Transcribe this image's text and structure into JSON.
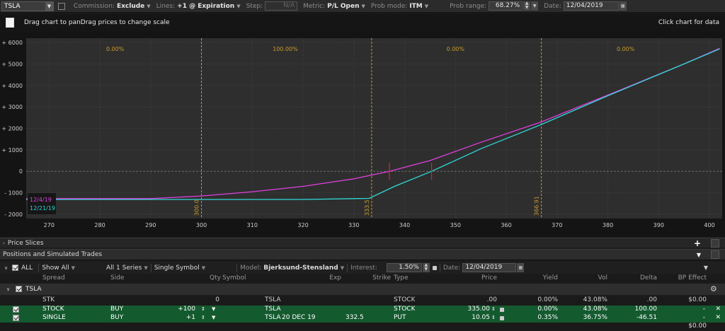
{
  "toolbar": {
    "symbol": "TSLA",
    "commission_label": "Commission:",
    "commission_value": "Exclude",
    "lines_label": "Lines:",
    "lines_value": "+1 @ Expiration",
    "step_label": "Step:",
    "step_value": "N/A",
    "metric_label": "Metric:",
    "metric_value": "P/L Open",
    "prob_mode_label": "Prob mode:",
    "prob_mode_value": "ITM",
    "prob_range_label": "Prob range:",
    "prob_range_value": "68.27%",
    "date_label": "Date:",
    "date_value": "12/04/2019"
  },
  "chart_header": {
    "hint": "Drag chart to panDrag prices to change scale",
    "click_hint": "Click chart for data"
  },
  "chart_data": {
    "type": "line",
    "x_ticks": [
      270,
      280,
      290,
      300,
      310,
      320,
      330,
      340,
      350,
      360,
      370,
      380,
      390,
      400
    ],
    "y_ticks": [
      "+ 6000",
      "+ 5000",
      "+ 4000",
      "+ 3000",
      "+ 2000",
      "+ 1000",
      "0",
      "- 1000",
      "- 2000"
    ],
    "y_tick_values": [
      6000,
      5000,
      4000,
      3000,
      2000,
      1000,
      0,
      -1000,
      -2000
    ],
    "xlim": [
      265.5,
      402.5
    ],
    "ylim": [
      -2200,
      6200
    ],
    "zones": [
      {
        "label": "0.00%",
        "x_center": 283
      },
      {
        "label": "100.00%",
        "x_center": 316.5
      },
      {
        "label": "0.00%",
        "x_center": 350
      },
      {
        "label": "0.00%",
        "x_center": 383.5
      }
    ],
    "vlines": [
      {
        "x": 300,
        "label": "300.0"
      },
      {
        "x": 333.5,
        "label": "333.5"
      },
      {
        "x": 366.91,
        "label": "366.91"
      }
    ],
    "markers": [
      337,
      345.3
    ],
    "series": [
      {
        "name": "12/4/19",
        "color": "#e040e0",
        "x": [
          265.5,
          290,
          300,
          310,
          320,
          330,
          337,
          345,
          355,
          366.91,
          380,
          395,
          402
        ],
        "y": [
          -1270,
          -1270,
          -1150,
          -950,
          -700,
          -350,
          0,
          500,
          1350,
          2300,
          3550,
          5000,
          5730
        ]
      },
      {
        "name": "12/21/19",
        "color": "#30d8d8",
        "x": [
          265.5,
          290,
          300,
          310,
          320,
          333,
          338,
          345.3,
          355,
          366.91,
          380,
          395,
          402
        ],
        "y": [
          -1310,
          -1310,
          -1310,
          -1310,
          -1310,
          -1260,
          -700,
          0,
          1050,
          2180,
          3520,
          5000,
          5700
        ]
      }
    ]
  },
  "price_slices": {
    "title": "Price Slices"
  },
  "positions": {
    "title": "Positions and Simulated Trades"
  },
  "controls": {
    "all_label": "ALL",
    "show_all": "Show All",
    "series": "All 1 Series",
    "symbol_mode": "Single Symbol",
    "model_label": "Model:",
    "model_value": "Bjerksund-Stensland",
    "interest_label": "Interest:",
    "interest_value": "1.50%",
    "date_label": "Date:",
    "date_value": "12/04/2019"
  },
  "table": {
    "headers": {
      "spread": "Spread",
      "side": "Side",
      "qty": "Qty",
      "symbol": "Symbol",
      "exp": "Exp",
      "strike": "Strike",
      "type": "Type",
      "price": "Price",
      "yield": "Yield",
      "vol": "Vol",
      "delta": "Delta",
      "bp": "BP Effect"
    },
    "group": "TSLA",
    "stk": {
      "spread": "STK",
      "qty": "0",
      "symbol": "TSLA",
      "type": "STOCK",
      "price": ".00",
      "yield": "0.00%",
      "vol": "43.08%",
      "delta": ".00",
      "bp": "$0.00"
    },
    "rows": [
      {
        "spread": "STOCK",
        "side": "BUY",
        "qty": "+100",
        "symbol": "TSLA",
        "exp": "",
        "strike": "",
        "type": "STOCK",
        "price": "335.00",
        "yield": "0.00%",
        "vol": "43.08%",
        "delta": "100.00",
        "bp": "-"
      },
      {
        "spread": "SINGLE",
        "side": "BUY",
        "qty": "+1",
        "symbol": "TSLA",
        "exp": "20 DEC 19",
        "strike": "332.5",
        "type": "PUT",
        "price": "10.05",
        "yield": "0.35%",
        "vol": "36.75%",
        "delta": "-46.51",
        "bp": "-"
      }
    ],
    "total_bp": "$0.00"
  },
  "colors": {
    "accent_green": "#145a2f",
    "curve_today": "#e040e0",
    "curve_exp": "#30d8d8",
    "zone": "#c99a2e"
  }
}
